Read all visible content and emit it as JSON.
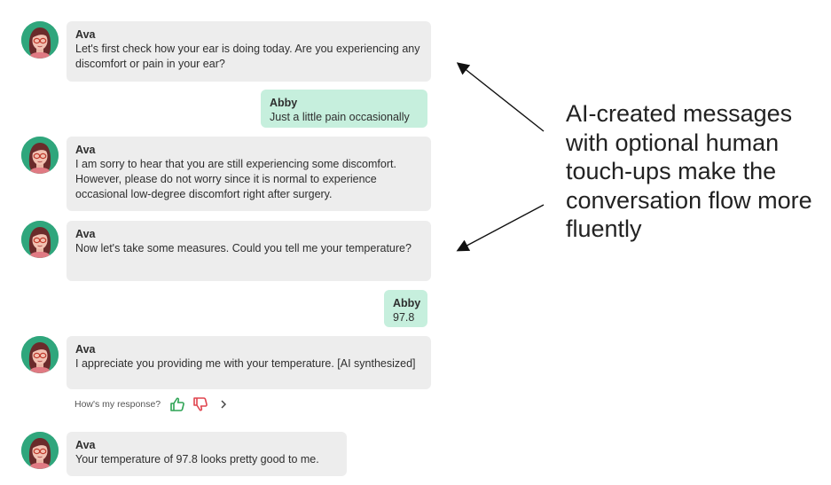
{
  "messages": [
    {
      "sender": "Ava",
      "text": "Let's first check how your ear is doing today. Are you experiencing any discomfort or pain in your ear?"
    },
    {
      "sender": "Abby",
      "text": "Just a little pain occasionally"
    },
    {
      "sender": "Ava",
      "text": "I am sorry to hear that you are still experiencing some discomfort. However, please do not worry since it is normal to experience occasional low-degree discomfort right after surgery."
    },
    {
      "sender": "Ava",
      "text": "Now let's take some measures. Could you tell me your temperature?"
    },
    {
      "sender": "Abby",
      "text": "97.8"
    },
    {
      "sender": "Ava",
      "text": "I appreciate you providing me with your temperature. [AI synthesized]"
    },
    {
      "sender": "Ava",
      "text": "Your temperature of 97.8 looks pretty good to me."
    }
  ],
  "feedback": {
    "prompt": "How's my response?",
    "icons": [
      "thumbs-up-icon",
      "thumbs-down-icon",
      "chevron-right-icon"
    ]
  },
  "annotation": {
    "text": "AI-created messages with optional human touch-ups make the conversation flow more fluently"
  },
  "colors": {
    "assistant_bubble": "#ededed",
    "user_bubble": "#c6efdd",
    "avatar_bg": "#2fa67c",
    "thumbs_up": "#2fa455",
    "thumbs_down": "#e0454f"
  }
}
